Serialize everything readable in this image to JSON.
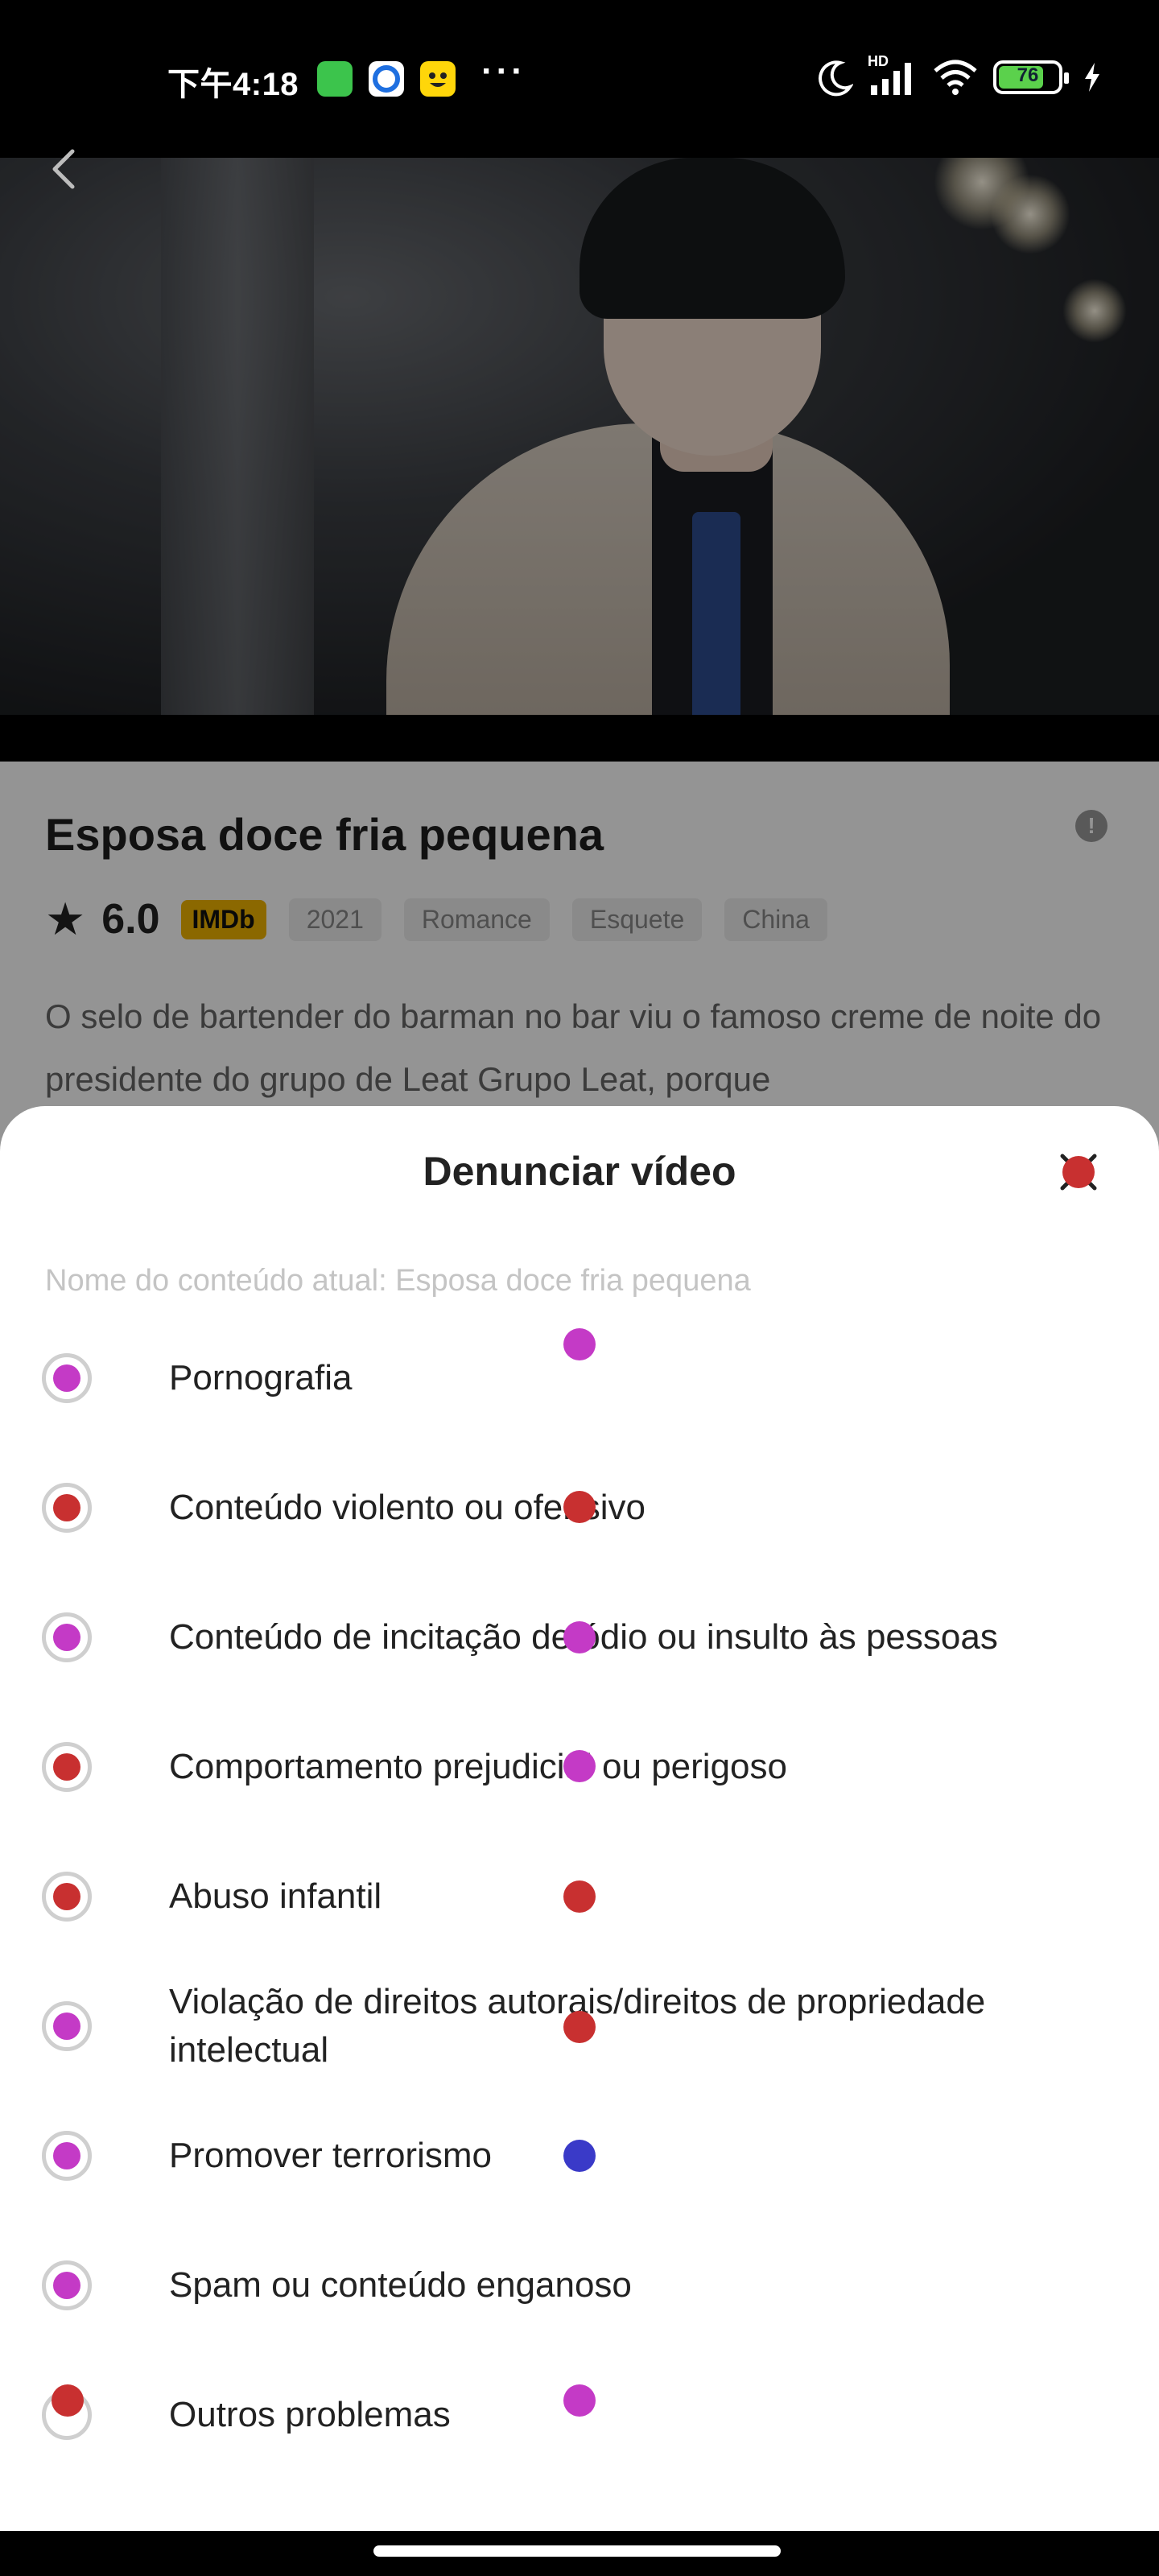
{
  "status_bar": {
    "time": "下午4:18",
    "battery": "76",
    "battery_level": 0.76,
    "network_badge": "HD",
    "icons": [
      "wechat-app-icon",
      "browser-app-icon",
      "emoji-app-icon",
      "moon-icon",
      "signal-icon",
      "wifi-icon",
      "battery-icon",
      "charging-icon"
    ]
  },
  "video": {
    "back_icon": "chevron-left-icon"
  },
  "movie": {
    "title": "Esposa doce fria pequena",
    "rating": "6.0",
    "imdb_badge": "IMDb",
    "tags": [
      "2021",
      "Romance",
      "Esquete",
      "China"
    ],
    "description": "O selo de bartender do barman no bar viu o famoso creme de noite do presidente do grupo de Leat Grupo Leat, porque"
  },
  "report_sheet": {
    "title": "Denunciar vídeo",
    "current_content": "Nome do conteúdo atual: Esposa doce fria pequena",
    "options": [
      {
        "label": "Pornografia"
      },
      {
        "label": "Conteúdo violento ou ofensivo"
      },
      {
        "label": "Conteúdo de incitação de ódio ou insulto às pessoas"
      },
      {
        "label": "Comportamento prejudicial ou perigoso"
      },
      {
        "label": "Abuso infantil"
      },
      {
        "label": "Violação de direitos autorais/direitos de propriedade intelectual"
      },
      {
        "label": "Promover terrorismo"
      },
      {
        "label": "Spam ou conteúdo enganoso"
      },
      {
        "label": "Outros problemas"
      }
    ]
  },
  "colors": {
    "accent_magenta": "#c43ac6",
    "accent_red": "#c83030",
    "accent_blue": "#3a3ac8",
    "imdb_yellow": "#f0b400"
  }
}
